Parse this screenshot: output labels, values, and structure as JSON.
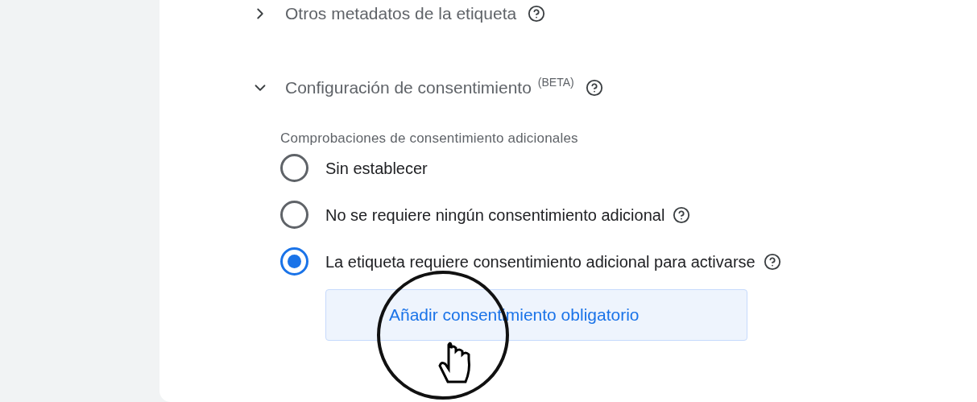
{
  "sections": [
    {
      "title": "Otros metadatos de la etiqueta",
      "expanded": false,
      "help": true
    },
    {
      "title": "Configuración de consentimiento",
      "superscript": "(BETA)",
      "expanded": true,
      "help": true,
      "group_label": "Comprobaciones de consentimiento adicionales",
      "options": [
        {
          "label": "Sin establecer",
          "selected": false,
          "help": false
        },
        {
          "label": "No se requiere ningún consentimiento adicional",
          "selected": false,
          "help": true
        },
        {
          "label": "La etiqueta requiere consentimiento adicional para activarse",
          "selected": true,
          "help": true
        }
      ],
      "add_button": "Añadir consentimiento obligatorio"
    }
  ]
}
